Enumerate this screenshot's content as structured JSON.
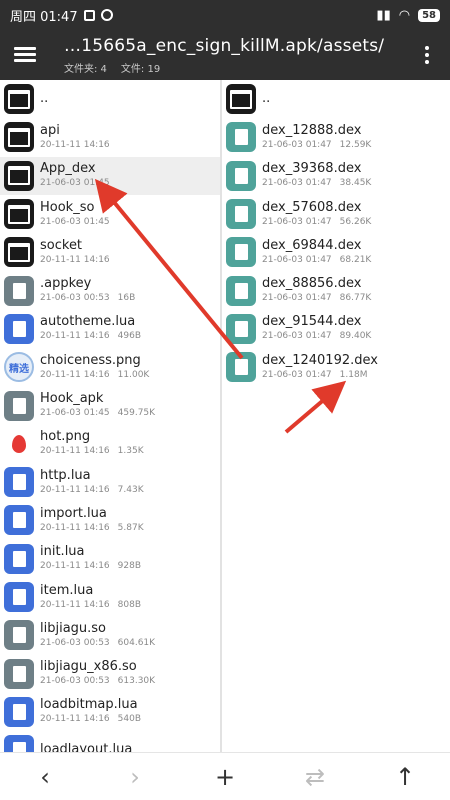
{
  "status": {
    "time": "周四 01:47",
    "battery": "58"
  },
  "toolbar": {
    "path": "…15665a_enc_sign_killM.apk/assets/",
    "folders_count": "文件夹: 4",
    "files_count": "文件: 19"
  },
  "left_pane": [
    {
      "name": "..",
      "meta": "",
      "size": "",
      "icon": "folder-icon"
    },
    {
      "name": "api",
      "meta": "20-11-11 14:16",
      "size": "",
      "icon": "folder-icon"
    },
    {
      "name": "App_dex",
      "meta": "21-06-03 01:45",
      "size": "",
      "icon": "folder-icon"
    },
    {
      "name": "Hook_so",
      "meta": "21-06-03 01:45",
      "size": "",
      "icon": "folder-icon"
    },
    {
      "name": "socket",
      "meta": "20-11-11 14:16",
      "size": "",
      "icon": "folder-icon"
    },
    {
      "name": ".appkey",
      "meta": "21-06-03 00:53",
      "size": "16B",
      "icon": "file-icon"
    },
    {
      "name": "autotheme.lua",
      "meta": "20-11-11 14:16",
      "size": "496B",
      "icon": "lua-icon"
    },
    {
      "name": "choiceness.png",
      "meta": "20-11-11 14:16",
      "size": "11.00K",
      "icon": "image-icon"
    },
    {
      "name": "Hook_apk",
      "meta": "21-06-03 01:45",
      "size": "459.75K",
      "icon": "file-icon"
    },
    {
      "name": "hot.png",
      "meta": "20-11-11 14:16",
      "size": "1.35K",
      "icon": "fire-icon"
    },
    {
      "name": "http.lua",
      "meta": "20-11-11 14:16",
      "size": "7.43K",
      "icon": "lua-icon"
    },
    {
      "name": "import.lua",
      "meta": "20-11-11 14:16",
      "size": "5.87K",
      "icon": "lua-icon"
    },
    {
      "name": "init.lua",
      "meta": "20-11-11 14:16",
      "size": "928B",
      "icon": "lua-icon"
    },
    {
      "name": "item.lua",
      "meta": "20-11-11 14:16",
      "size": "808B",
      "icon": "lua-icon"
    },
    {
      "name": "libjiagu.so",
      "meta": "21-06-03 00:53",
      "size": "604.61K",
      "icon": "file-icon"
    },
    {
      "name": "libjiagu_x86.so",
      "meta": "21-06-03 00:53",
      "size": "613.30K",
      "icon": "file-icon"
    },
    {
      "name": "loadbitmap.lua",
      "meta": "20-11-11 14:16",
      "size": "540B",
      "icon": "lua-icon"
    },
    {
      "name": "loadlayout.lua",
      "meta": "",
      "size": "",
      "icon": "lua-icon"
    }
  ],
  "right_pane": [
    {
      "name": "..",
      "meta": "",
      "size": "",
      "icon": "folder-icon"
    },
    {
      "name": "dex_12888.dex",
      "meta": "21-06-03 01:47",
      "size": "12.59K",
      "icon": "dex-icon"
    },
    {
      "name": "dex_39368.dex",
      "meta": "21-06-03 01:47",
      "size": "38.45K",
      "icon": "dex-icon"
    },
    {
      "name": "dex_57608.dex",
      "meta": "21-06-03 01:47",
      "size": "56.26K",
      "icon": "dex-icon"
    },
    {
      "name": "dex_69844.dex",
      "meta": "21-06-03 01:47",
      "size": "68.21K",
      "icon": "dex-icon"
    },
    {
      "name": "dex_88856.dex",
      "meta": "21-06-03 01:47",
      "size": "86.77K",
      "icon": "dex-icon"
    },
    {
      "name": "dex_91544.dex",
      "meta": "21-06-03 01:47",
      "size": "89.40K",
      "icon": "dex-icon"
    },
    {
      "name": "dex_1240192.dex",
      "meta": "21-06-03 01:47",
      "size": "1.18M",
      "icon": "dex-icon"
    }
  ],
  "bottom": {
    "back": "‹",
    "forward": "›",
    "add": "+",
    "swap": "⇄",
    "up": "↑"
  },
  "colors": {
    "bar": "#2f2f2f",
    "folder": "#1a1a1a",
    "lua": "#3f6fd9",
    "dex": "#4fa39a",
    "file": "#6e7f86",
    "arrow": "#e03a2b"
  }
}
